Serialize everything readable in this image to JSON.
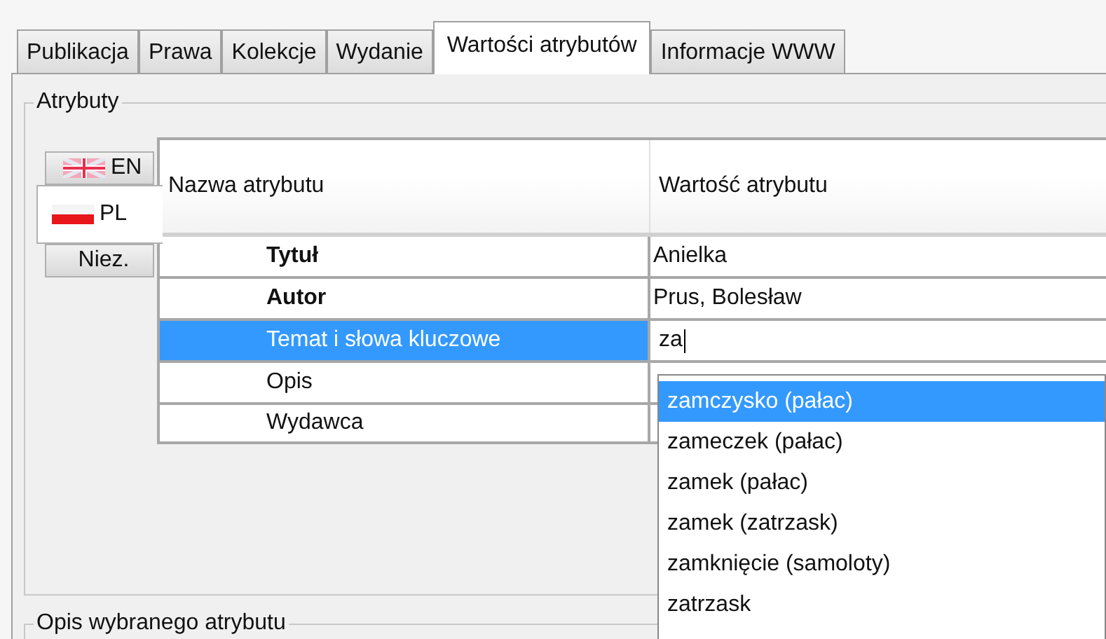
{
  "tabs": [
    {
      "label": "Publikacja",
      "selected": false
    },
    {
      "label": "Prawa",
      "selected": false
    },
    {
      "label": "Kolekcje",
      "selected": false
    },
    {
      "label": "Wydanie",
      "selected": false
    },
    {
      "label": "Wartości atrybutów",
      "selected": true
    },
    {
      "label": "Informacje WWW",
      "selected": false
    }
  ],
  "attributes_group": {
    "title": "Atrybuty",
    "languages": [
      {
        "label": "EN",
        "kind": "english",
        "selected": false
      },
      {
        "label": "PL",
        "kind": "polish",
        "selected": true
      },
      {
        "label": "Niez.",
        "kind": "plain",
        "selected": false
      }
    ],
    "table": {
      "columns": [
        "Nazwa atrybutu",
        "Wartość atrybutu"
      ],
      "rows": [
        {
          "name": "Tytuł",
          "value": "Anielka",
          "required": true,
          "selected": false
        },
        {
          "name": "Autor",
          "value": "Prus, Bolesław",
          "required": true,
          "selected": false
        },
        {
          "name": "Temat i słowa kluczowe",
          "value": "za",
          "editing": true,
          "required": false,
          "selected": true
        },
        {
          "name": "Opis",
          "required": false,
          "selected": false
        },
        {
          "name": "Wydawca",
          "required": false,
          "selected": false
        }
      ]
    },
    "suggestions": [
      {
        "label": "zamczysko (pałac)",
        "selected": true
      },
      {
        "label": "zameczek (pałac)",
        "selected": false
      },
      {
        "label": "zamek (pałac)",
        "selected": false
      },
      {
        "label": "zamek (zatrzask)",
        "selected": false
      },
      {
        "label": "zamknięcie (samoloty)",
        "selected": false
      },
      {
        "label": "zatrzask",
        "selected": false
      }
    ]
  },
  "description_group": {
    "title": "Opis wybranego atrybutu"
  }
}
